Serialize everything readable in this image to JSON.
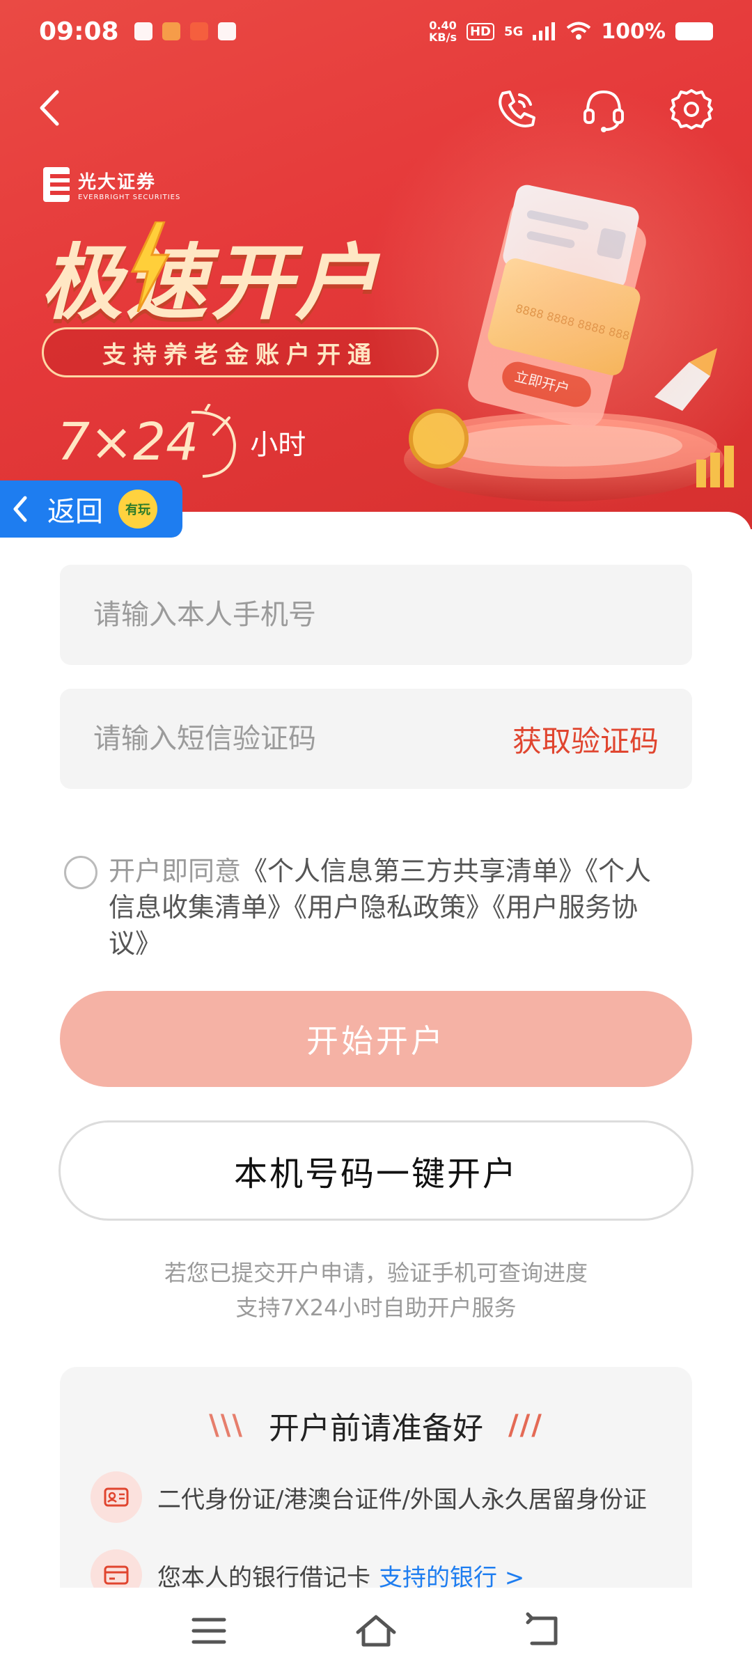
{
  "status_bar": {
    "time": "09:08",
    "net_speed": "0.40\nKB/s",
    "hd": "HD",
    "signal": "5G",
    "battery": "100%"
  },
  "banner": {
    "brand_cn": "光大证券",
    "brand_en": "EVERBRIGHT SECURITIES",
    "headline": "极速开户",
    "pill": "支持养老金账户开通",
    "hours_number": "7×24",
    "hours_unit": "小时",
    "card_label": "立即开户",
    "card_number": "8888 8888 8888 888"
  },
  "float_back": {
    "label": "返回",
    "avatar": "有玩"
  },
  "form": {
    "phone_placeholder": "请输入本人手机号",
    "sms_placeholder": "请输入短信验证码",
    "get_code": "获取验证码",
    "agree_prefix": "开户即同意",
    "agree_links": "《个人信息第三方共享清单》《个人信息收集清单》《用户隐私政策》《用户服务协议》",
    "start_button": "开始开户",
    "one_click_button": "本机号码一键开户",
    "hint_line1": "若您已提交开户申请，验证手机可查询进度",
    "hint_line2": "支持7X24小时自助开户服务"
  },
  "prepare": {
    "title": "开户前请准备好",
    "items": [
      {
        "text": "二代身份证/港澳台证件/外国人永久居留身份证",
        "link": ""
      },
      {
        "text": "您本人的银行借记卡",
        "link": "支持的银行 >"
      }
    ]
  },
  "colors": {
    "banner_red": "#e5393a",
    "accent_red": "#e0452f",
    "primary_disabled": "#f5b2a5",
    "link_blue": "#1e7df0"
  }
}
